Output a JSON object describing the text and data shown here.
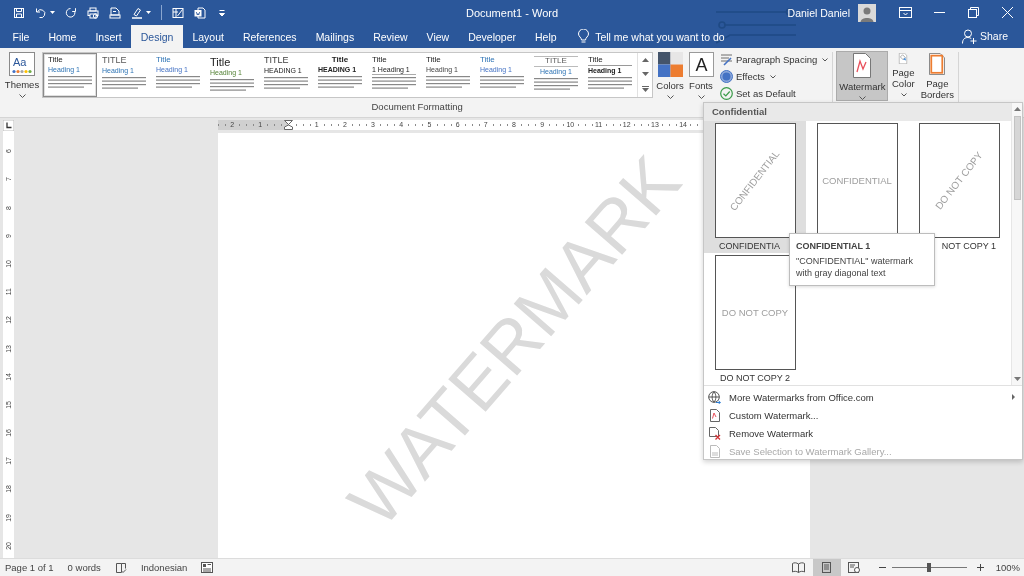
{
  "title_bar": {
    "quick_access": [
      {
        "kind": "save",
        "menu": false
      },
      {
        "kind": "undo",
        "menu": true
      },
      {
        "kind": "redo",
        "menu": false
      },
      {
        "kind": "print",
        "menu": false
      },
      {
        "kind": "preview",
        "menu": false
      },
      {
        "kind": "highlight",
        "menu": true
      },
      {
        "kind": "separator"
      },
      {
        "kind": "form",
        "menu": false
      },
      {
        "kind": "document",
        "menu": false
      },
      {
        "kind": "customize",
        "menu": false
      }
    ],
    "title": "Document1 - Word",
    "user": "Daniel Daniel"
  },
  "tabs": [
    {
      "label": "File",
      "selected": false
    },
    {
      "label": "Home",
      "selected": false
    },
    {
      "label": "Insert",
      "selected": false
    },
    {
      "label": "Design",
      "selected": true
    },
    {
      "label": "Layout",
      "selected": false
    },
    {
      "label": "References",
      "selected": false
    },
    {
      "label": "Mailings",
      "selected": false
    },
    {
      "label": "Review",
      "selected": false
    },
    {
      "label": "View",
      "selected": false
    },
    {
      "label": "Developer",
      "selected": false
    },
    {
      "label": "Help",
      "selected": false
    }
  ],
  "tell_me": {
    "placeholder": "Tell me what you want to do"
  },
  "share": "Share",
  "ribbon": {
    "themes": {
      "glyph": "Aa",
      "label": "Themes"
    },
    "style_sets": [
      {
        "kind": "basic",
        "title": "Title",
        "heading": "Heading 1",
        "selected": true
      },
      {
        "kind": "caps",
        "title": "TITLE",
        "heading": "Heading 1",
        "selected": false
      },
      {
        "kind": "accent",
        "title": "Title",
        "heading": "Heading 1",
        "selected": false
      },
      {
        "kind": "large",
        "title": "Title",
        "heading": "Heading 1",
        "selected": false
      },
      {
        "kind": "formal",
        "title": "TITLE",
        "heading": "HEADING 1",
        "selected": false
      },
      {
        "kind": "centered",
        "title": "Title",
        "heading": "HEADING 1",
        "selected": false
      },
      {
        "kind": "numbered",
        "title": "Title",
        "heading": "1 Heading 1",
        "selected": false
      },
      {
        "kind": "plain",
        "title": "Title",
        "heading": "Heading 1",
        "selected": false
      },
      {
        "kind": "accent",
        "title": "Title",
        "heading": "Heading 1",
        "selected": false
      },
      {
        "kind": "ruled",
        "title": "TITLE",
        "heading": "Heading 1",
        "selected": false
      },
      {
        "kind": "underlined",
        "title": "Title",
        "heading": "Heading 1",
        "selected": false
      }
    ],
    "colors": {
      "label": "Colors"
    },
    "fonts": {
      "glyph": "A",
      "label": "Fonts"
    },
    "options": [
      {
        "kind": "spacing",
        "label": "Paragraph Spacing",
        "menu": true
      },
      {
        "kind": "effects",
        "label": "Effects",
        "menu": true
      },
      {
        "kind": "default",
        "label": "Set as Default",
        "menu": false
      }
    ],
    "group_label": "Document Formatting",
    "page_background": [
      {
        "kind": "watermark",
        "label": "Watermark",
        "selected": true,
        "menu": true
      },
      {
        "kind": "color",
        "label": "Page Color",
        "selected": false,
        "menu": true
      },
      {
        "kind": "borders",
        "label": "Page Borders",
        "selected": false,
        "menu": false
      }
    ]
  },
  "document": {
    "top_ruler": {
      "left_numbers": [
        "2",
        "1"
      ],
      "numbers": [
        "1",
        "2",
        "3",
        "4",
        "5",
        "6",
        "7",
        "8",
        "9",
        "10",
        "11",
        "12",
        "13",
        "14"
      ]
    },
    "left_ruler": {
      "numbers": [
        "6",
        "7",
        "8",
        "9",
        "10",
        "11",
        "12",
        "13",
        "14",
        "15",
        "16",
        "17",
        "18",
        "19",
        "20"
      ]
    },
    "watermark": "WATERMARK"
  },
  "watermark_menu": {
    "section": "Confidential",
    "items": [
      {
        "kind": "diagonal",
        "preview": "CONFIDENTIAL",
        "label": "CONFIDENTIA",
        "selected": true
      },
      {
        "kind": "horizontal",
        "preview": "CONFIDENTIAL",
        "selected": false
      },
      {
        "kind": "diagonal",
        "preview": "DO NOT COPY",
        "label": "NOT COPY 1",
        "selected": false
      },
      {
        "kind": "horizontal",
        "preview": "DO NOT COPY",
        "label": "DO NOT COPY 2",
        "selected": false
      }
    ],
    "tooltip": {
      "title": "CONFIDENTIAL 1",
      "text": "\"CONFIDENTIAL\" watermark with gray diagonal text"
    },
    "actions": [
      {
        "kind": "globe",
        "label": "More Watermarks from Office.com",
        "submenu": true,
        "disabled": false
      },
      {
        "kind": "custom",
        "label": "Custom Watermark...",
        "submenu": false,
        "disabled": false
      },
      {
        "kind": "remove",
        "label": "Remove Watermark",
        "submenu": false,
        "disabled": false
      },
      {
        "kind": "save",
        "label": "Save Selection to Watermark Gallery...",
        "submenu": false,
        "disabled": true
      }
    ]
  },
  "status_bar": {
    "page": "Page 1 of 1",
    "words": "0 words",
    "language": "Indonesian",
    "views": [
      {
        "kind": "read",
        "selected": false
      },
      {
        "kind": "print",
        "selected": true
      },
      {
        "kind": "web",
        "selected": false
      }
    ],
    "zoom": {
      "level": 0.5,
      "reading": "100%"
    }
  }
}
